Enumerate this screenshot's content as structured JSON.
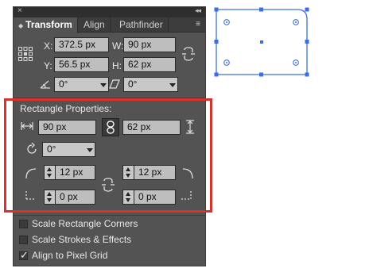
{
  "panel": {
    "close_glyph": "×",
    "collapse_glyph": "◂◂",
    "tabs": [
      {
        "label": "Transform",
        "active": true
      },
      {
        "label": "Align",
        "active": false
      },
      {
        "label": "Pathfinder",
        "active": false
      }
    ],
    "menu_glyph": "≡"
  },
  "transform": {
    "x_label": "X:",
    "x_value": "372.5 px",
    "w_label": "W:",
    "w_value": "90 px",
    "y_label": "Y:",
    "y_value": "56.5 px",
    "h_label": "H:",
    "h_value": "62 px",
    "rotate_value": "0°",
    "shear_value": "0°"
  },
  "rect_props": {
    "title": "Rectangle Properties:",
    "width_value": "90 px",
    "height_value": "62 px",
    "rotation_value": "0°",
    "corner_tl": "12 px",
    "corner_tr": "12 px",
    "corner_bl": "0 px",
    "corner_br": "0 px"
  },
  "options": [
    {
      "label": "Scale Rectangle Corners",
      "checked": false
    },
    {
      "label": "Scale Strokes & Effects",
      "checked": false
    },
    {
      "label": "Align to Pixel Grid",
      "checked": true
    }
  ],
  "colors": {
    "panel_bg": "#535353",
    "highlight": "#d9322a",
    "selection": "#3b6ee0"
  }
}
